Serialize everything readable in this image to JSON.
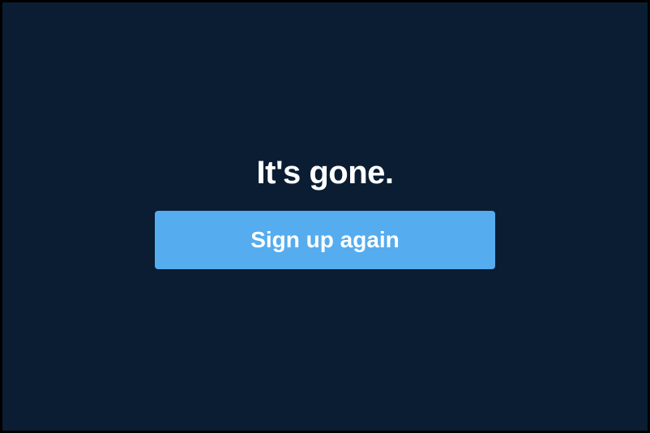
{
  "main": {
    "heading": "It's gone.",
    "cta_label": "Sign up again"
  },
  "colors": {
    "background": "#0a1d33",
    "button": "#55acee",
    "text": "#ffffff"
  }
}
